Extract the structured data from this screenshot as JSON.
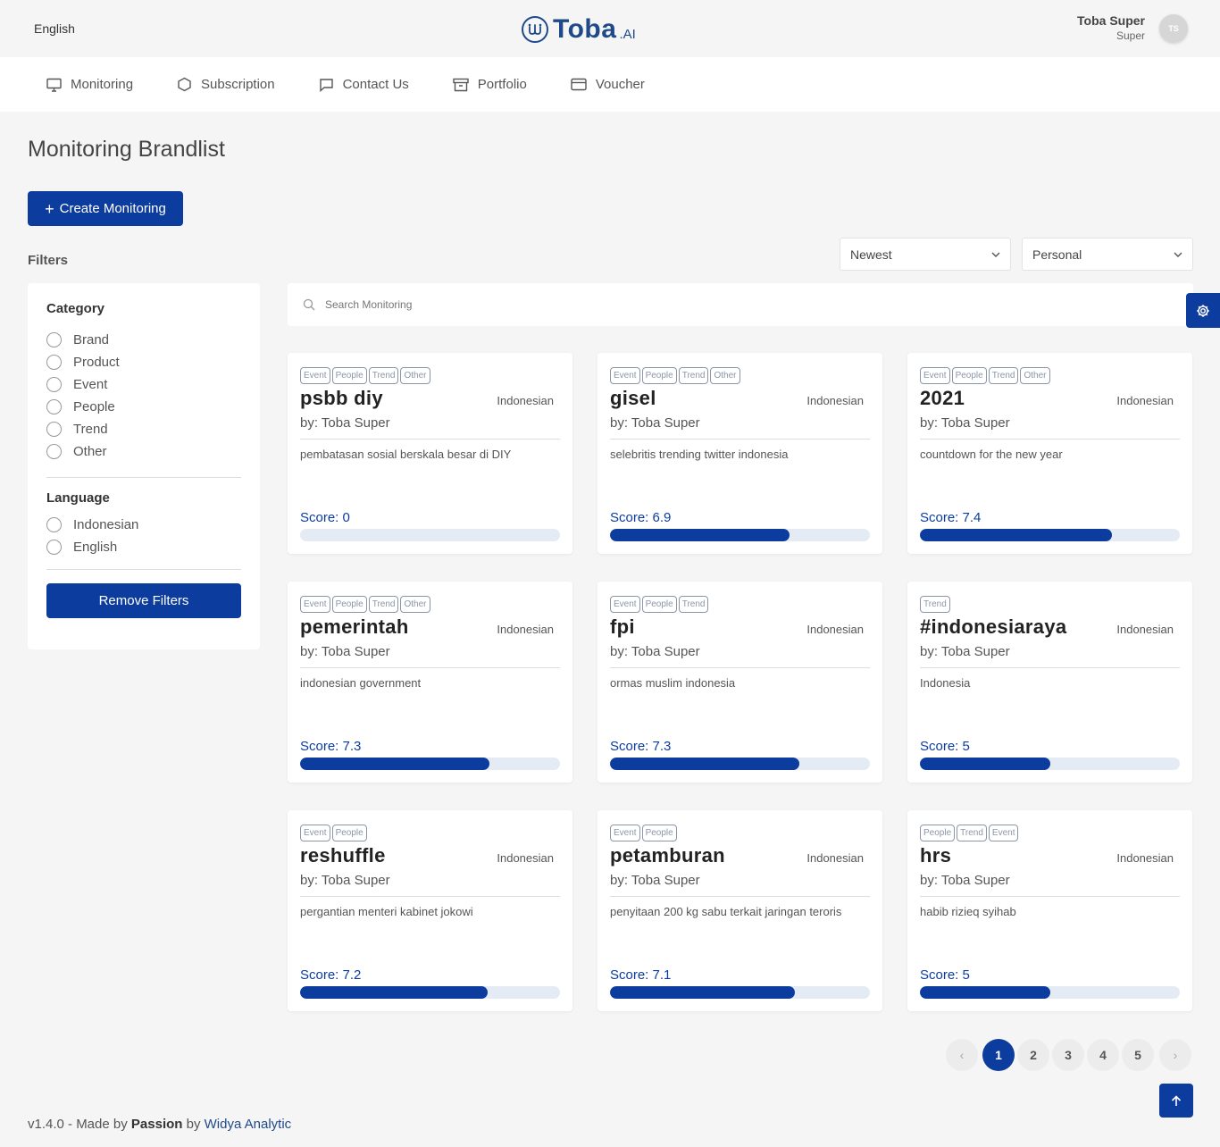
{
  "header": {
    "language": "English",
    "logo_text": "Toba",
    "logo_suffix": ".AI",
    "user_name": "Toba Super",
    "user_role": "Super",
    "avatar_initials": "TS"
  },
  "nav": [
    {
      "label": "Monitoring",
      "icon": "monitor-icon"
    },
    {
      "label": "Subscription",
      "icon": "hexagon-icon"
    },
    {
      "label": "Contact Us",
      "icon": "chat-icon"
    },
    {
      "label": "Portfolio",
      "icon": "archive-icon"
    },
    {
      "label": "Voucher",
      "icon": "credit-card-icon"
    }
  ],
  "page": {
    "title": "Monitoring Brandlist",
    "create_label": "Create Monitoring",
    "filters_label": "Filters",
    "sort_value": "Newest",
    "scope_value": "Personal",
    "search_placeholder": "Search Monitoring"
  },
  "filters": {
    "category_heading": "Category",
    "categories": [
      "Brand",
      "Product",
      "Event",
      "People",
      "Trend",
      "Other"
    ],
    "language_heading": "Language",
    "languages": [
      "Indonesian",
      "English"
    ],
    "remove_label": "Remove Filters"
  },
  "cards": [
    {
      "tags": [
        "Event",
        "People",
        "Trend",
        "Other"
      ],
      "title": "psbb diy",
      "language": "Indonesian",
      "by": "by: Toba Super",
      "description": "pembatasan sosial berskala besar di DIY",
      "score_label": "Score: 0",
      "score": 0
    },
    {
      "tags": [
        "Event",
        "People",
        "Trend",
        "Other"
      ],
      "title": "gisel",
      "language": "Indonesian",
      "by": "by: Toba Super",
      "description": "selebritis trending twitter indonesia",
      "score_label": "Score: 6.9",
      "score": 6.9
    },
    {
      "tags": [
        "Event",
        "People",
        "Trend",
        "Other"
      ],
      "title": "2021",
      "language": "Indonesian",
      "by": "by: Toba Super",
      "description": "countdown for the new year",
      "score_label": "Score: 7.4",
      "score": 7.4
    },
    {
      "tags": [
        "Event",
        "People",
        "Trend",
        "Other"
      ],
      "title": "pemerintah",
      "language": "Indonesian",
      "by": "by: Toba Super",
      "description": "indonesian government",
      "score_label": "Score: 7.3",
      "score": 7.3
    },
    {
      "tags": [
        "Event",
        "People",
        "Trend"
      ],
      "title": "fpi",
      "language": "Indonesian",
      "by": "by: Toba Super",
      "description": "ormas muslim indonesia",
      "score_label": "Score: 7.3",
      "score": 7.3
    },
    {
      "tags": [
        "Trend"
      ],
      "title": "#indonesiaraya",
      "language": "Indonesian",
      "by": "by: Toba Super",
      "description": "Indonesia",
      "score_label": "Score: 5",
      "score": 5
    },
    {
      "tags": [
        "Event",
        "People"
      ],
      "title": "reshuffle",
      "language": "Indonesian",
      "by": "by: Toba Super",
      "description": "pergantian menteri kabinet jokowi",
      "score_label": "Score: 7.2",
      "score": 7.2
    },
    {
      "tags": [
        "Event",
        "People"
      ],
      "title": "petamburan",
      "language": "Indonesian",
      "by": "by: Toba Super",
      "description": "penyitaan 200 kg sabu terkait jaringan teroris",
      "score_label": "Score: 7.1",
      "score": 7.1
    },
    {
      "tags": [
        "People",
        "Trend",
        "Event"
      ],
      "title": "hrs",
      "language": "Indonesian",
      "by": "by: Toba Super",
      "description": "habib rizieq syihab",
      "score_label": "Score: 5",
      "score": 5
    }
  ],
  "score_max": 10,
  "pagination": {
    "pages": [
      "1",
      "2",
      "3",
      "4",
      "5"
    ],
    "current": "1",
    "prev": "‹",
    "next": "›"
  },
  "footer": {
    "prefix": "v1.4.0 - Made by ",
    "passion": "Passion",
    "by": " by ",
    "company": "Widya Analytic"
  },
  "colors": {
    "primary": "#0c3c9e",
    "brand": "#1f4a8a",
    "bar_track": "#e5ebf5"
  }
}
